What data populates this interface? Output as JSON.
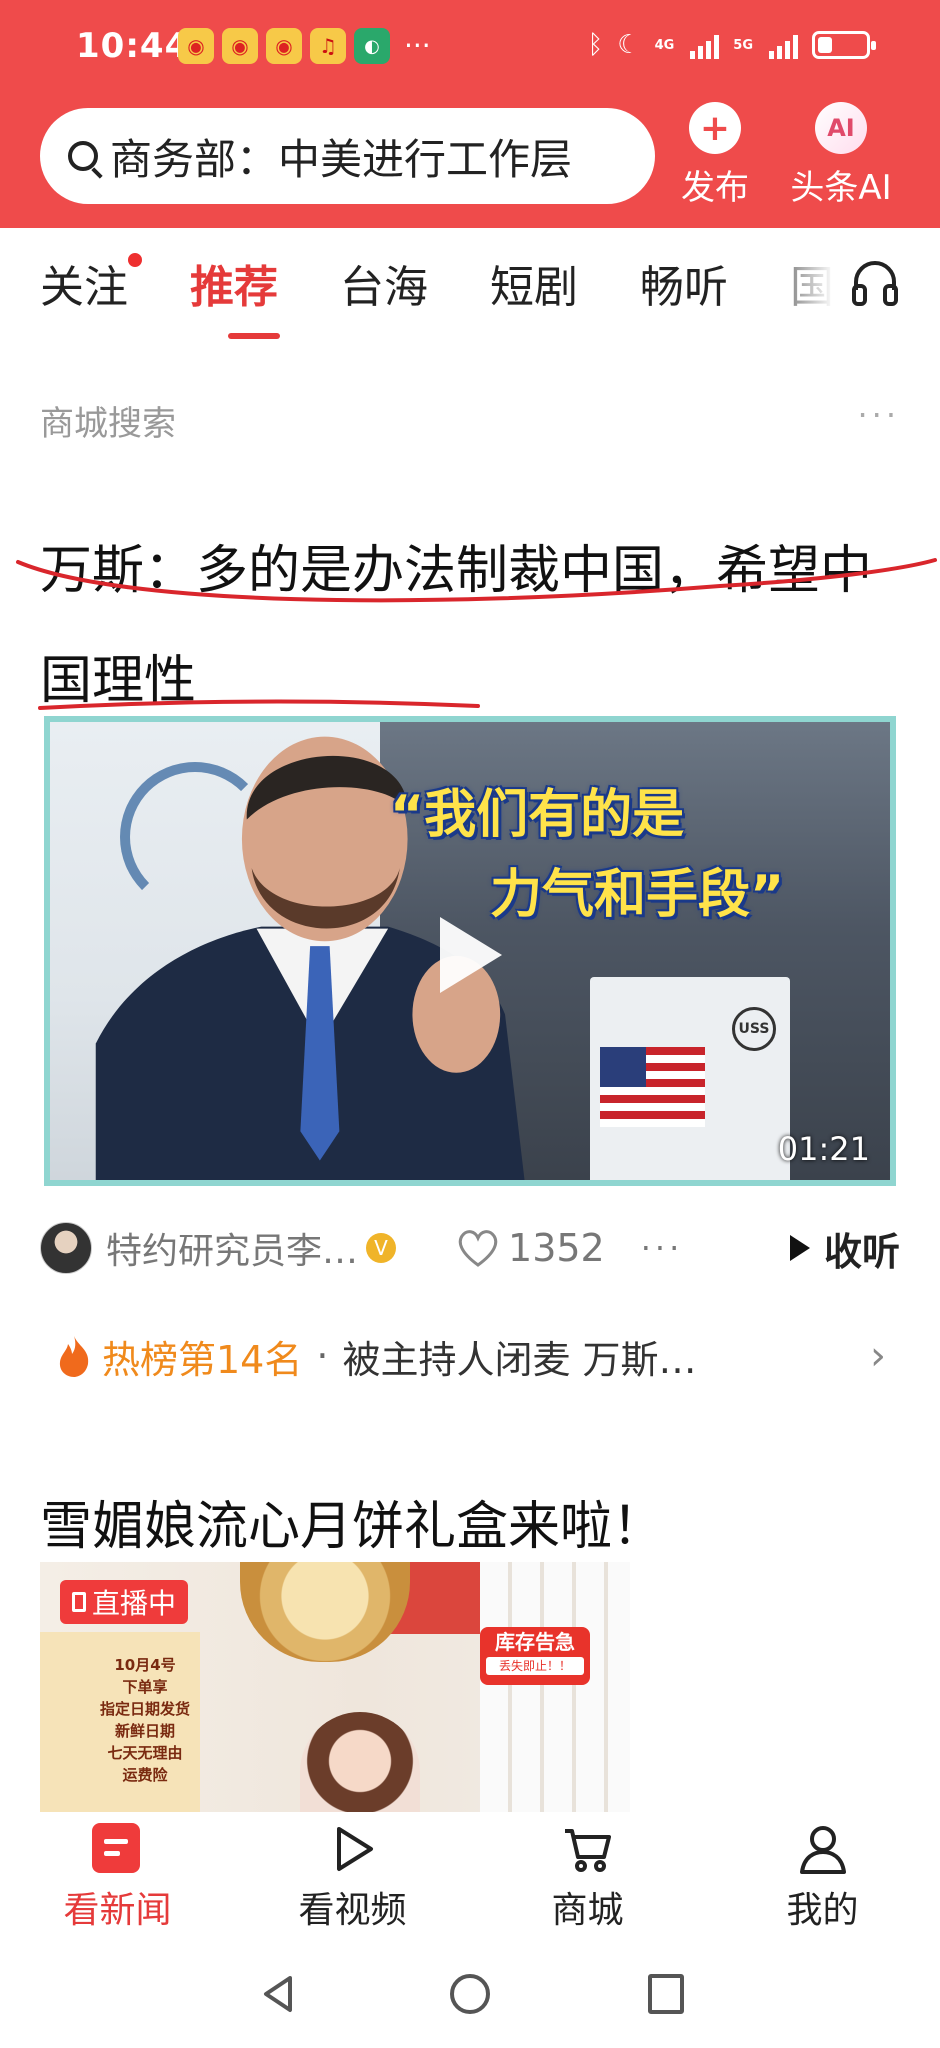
{
  "status_bar": {
    "time": "10:44",
    "network_1": "4G",
    "network_2": "5G",
    "battery_level": 0.3,
    "more": "···"
  },
  "header": {
    "search_query": "商务部：中美进行工作层",
    "publish_label": "发布",
    "publish_icon": "+",
    "ai_label": "头条AI",
    "ai_icon": "AI"
  },
  "tabs": [
    {
      "label": "关注",
      "badge": true
    },
    {
      "label": "推荐",
      "active": true
    },
    {
      "label": "台海"
    },
    {
      "label": "短剧"
    },
    {
      "label": "畅听"
    },
    {
      "label": "国"
    }
  ],
  "feed": {
    "section_label": "商城搜索",
    "more": "···",
    "article": {
      "headline": "万斯：多的是办法制裁中国，希望中国理性",
      "video_caption_line1": "“我们有的是",
      "video_caption_line2": "力气和手段”",
      "duration": "01:21",
      "author": "特约研究员李…",
      "verified_mark": "V",
      "likes": "1352",
      "more": "···",
      "listen_label": "收听"
    },
    "hot": {
      "rank_label": "热榜第14名",
      "separator": "·",
      "text": "被主持人闭麦 万斯…",
      "chevron": "›"
    },
    "ad": {
      "title": "雪媚娘流心月饼礼盒来啦！",
      "live_label": "直播中",
      "stock_label": "库存告急",
      "stock_sub": "丢失即止！！",
      "shelf_lines": [
        "10月4号",
        "下单享",
        "指定日期发货",
        "新鲜日期",
        "七天无理由",
        "运费险"
      ]
    }
  },
  "bottom_nav": [
    {
      "label": "看新闻",
      "icon": "news-icon",
      "active": true
    },
    {
      "label": "看视频",
      "icon": "play-icon"
    },
    {
      "label": "商城",
      "icon": "cart-icon"
    },
    {
      "label": "我的",
      "icon": "profile-icon"
    }
  ],
  "colors": {
    "brand_red": "#ef4b4b",
    "active_tab": "#e53a3a",
    "hot_orange": "#f08a1c",
    "annotation_red": "#d9262c"
  }
}
